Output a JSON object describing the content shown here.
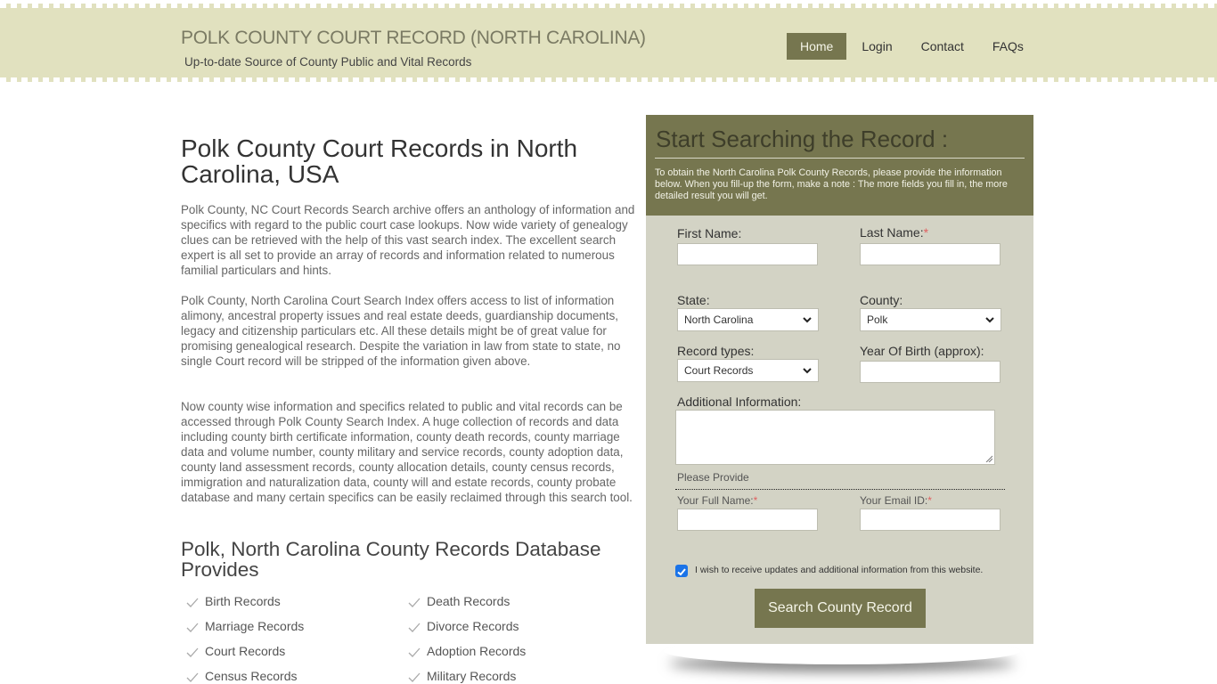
{
  "header": {
    "title": "POLK COUNTY COURT RECORD (NORTH CAROLINA)",
    "subtitle": "Up-to-date Source of  County Public and Vital Records",
    "nav": [
      {
        "label": "Home",
        "active": true
      },
      {
        "label": "Login",
        "active": false
      },
      {
        "label": "Contact",
        "active": false
      },
      {
        "label": "FAQs",
        "active": false
      }
    ]
  },
  "content": {
    "heading": "Polk County Court Records in North Carolina, USA",
    "paragraphs": [
      "Polk County, NC Court Records Search archive offers an anthology of information and specifics with regard to the public court case lookups. Now wide variety of genealogy clues can be retrieved with the help of this vast search index. The excellent search expert is all set to provide an array of records and information related to numerous familial particulars and hints.",
      "Polk County, North Carolina Court Search Index offers access to list of information alimony, ancestral property issues and real estate deeds, guardianship documents, legacy and citizenship particulars etc. All these details might be of great value for promising genealogical research. Despite the variation in law from state to state, no single Court record will be stripped of the information given above.",
      "Now county wise information and specifics related to public and vital records can be accessed through Polk County Search Index. A huge collection of records and data including county birth certificate information, county death records, county marriage data and volume number, county military and service records, county adoption data, county land assessment records, county allocation details, county census records, immigration and naturalization data, county will and estate records, county probate database and many certain specifics can be easily reclaimed through this search tool."
    ],
    "subheading": "Polk, North Carolina County Records Database Provides",
    "records": [
      "Birth Records",
      "Death Records",
      "Marriage Records",
      "Divorce Records",
      "Court Records",
      "Adoption Records",
      "Census Records",
      "Military Records"
    ]
  },
  "form": {
    "title": "Start Searching the Record :",
    "description": "To obtain the North Carolina Polk County Records, please provide the information below. When you fill-up the form, make a note : The more fields you fill in, the more detailed result you will get.",
    "first_name_label": "First Name:",
    "first_name_value": "",
    "last_name_label": "Last Name:",
    "last_name_value": "",
    "required_mark": "*",
    "state_label": "State:",
    "state_value": "North Carolina",
    "county_label": "County:",
    "county_value": "Polk",
    "record_types_label": "Record types:",
    "record_types_value": "Court Records",
    "year_of_birth_label": "Year Of Birth (approx):",
    "year_of_birth_value": "",
    "additional_info_label": "Additional Information:",
    "additional_info_value": "",
    "please_provide": "Please Provide",
    "full_name_label": "Your Full Name:",
    "full_name_value": "",
    "email_label": "Your Email ID:",
    "email_value": "",
    "updates_checked": true,
    "updates_label": "I wish to receive updates and additional information from this website.",
    "submit_label": "Search County Record"
  },
  "colors": {
    "header_bg": "#e1e1bf",
    "accent": "#76764f",
    "panel_bg": "#d3d3c5",
    "required": "#e06060",
    "checkbox": "#1a73e8"
  }
}
